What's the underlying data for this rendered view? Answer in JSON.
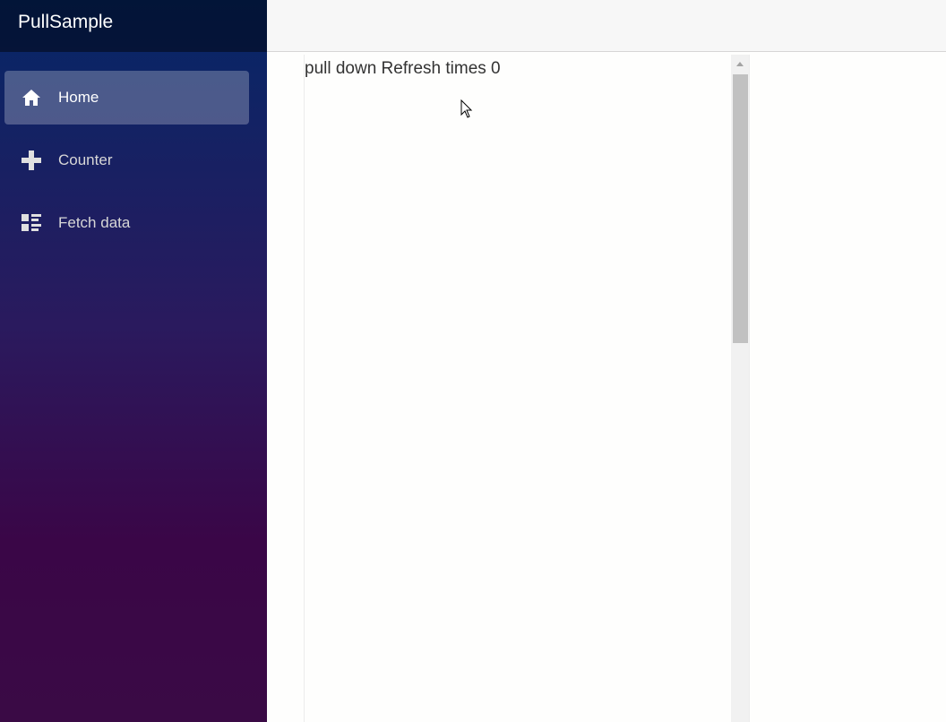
{
  "app": {
    "brand": "PullSample"
  },
  "sidebar": {
    "items": [
      {
        "label": "Home",
        "icon": "home-icon",
        "active": true
      },
      {
        "label": "Counter",
        "icon": "plus-icon",
        "active": false
      },
      {
        "label": "Fetch data",
        "icon": "list-rich-icon",
        "active": false
      }
    ]
  },
  "main": {
    "pull_text": "pull down Refresh times 0"
  },
  "colors": {
    "sidebar_top": "#052767",
    "sidebar_bottom": "#3a0647",
    "active_item": "rgba(255,255,255,0.25)",
    "text": "#333333"
  }
}
